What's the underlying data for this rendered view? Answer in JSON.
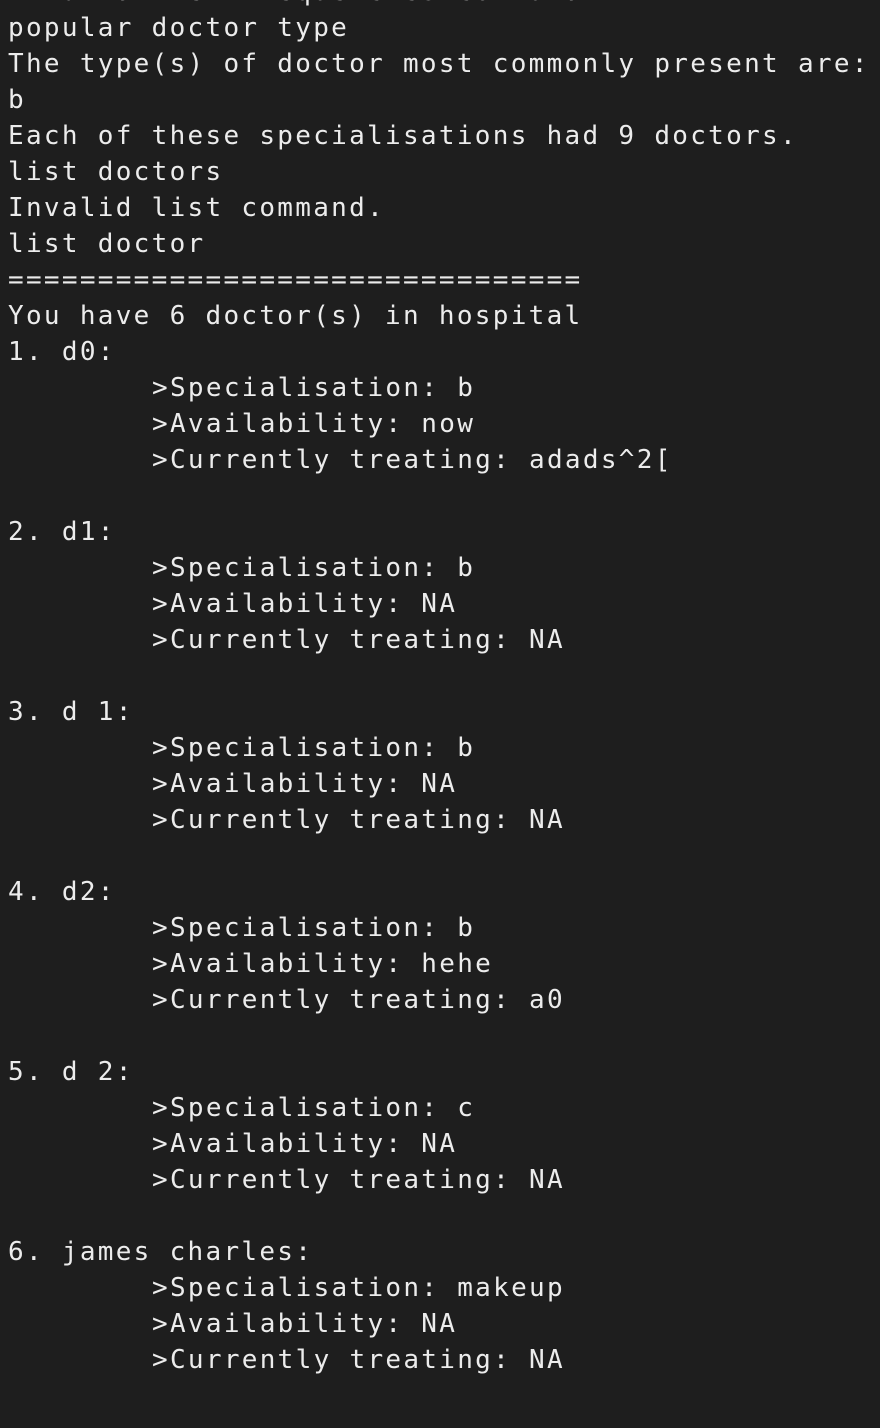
{
  "terminal": {
    "history": [
      "Invalid view frequencies command.",
      "popular doctor type",
      "The type(s) of doctor most commonly present are:",
      "b",
      "Each of these specialisations had 9 doctors.",
      "list doctors",
      "Invalid list command.",
      "list doctor",
      "================================",
      "You have 6 doctor(s) in hospital"
    ],
    "doctors": [
      {
        "header": "1. d0:",
        "specialisation": ">Specialisation: b",
        "availability": ">Availability: now",
        "treating": ">Currently treating: adads^2["
      },
      {
        "header": "2. d1:",
        "specialisation": ">Specialisation: b",
        "availability": ">Availability: NA",
        "treating": ">Currently treating: NA"
      },
      {
        "header": "3. d 1:",
        "specialisation": ">Specialisation: b",
        "availability": ">Availability: NA",
        "treating": ">Currently treating: NA"
      },
      {
        "header": "4. d2:",
        "specialisation": ">Specialisation: b",
        "availability": ">Availability: hehe",
        "treating": ">Currently treating: a0"
      },
      {
        "header": "5. d 2:",
        "specialisation": ">Specialisation: c",
        "availability": ">Availability: NA",
        "treating": ">Currently treating: NA"
      },
      {
        "header": "6. james charles:",
        "specialisation": ">Specialisation: makeup",
        "availability": ">Availability: NA",
        "treating": ">Currently treating: NA"
      }
    ]
  },
  "colors": {
    "background": "#1e1e1e",
    "text": "#ececec"
  }
}
